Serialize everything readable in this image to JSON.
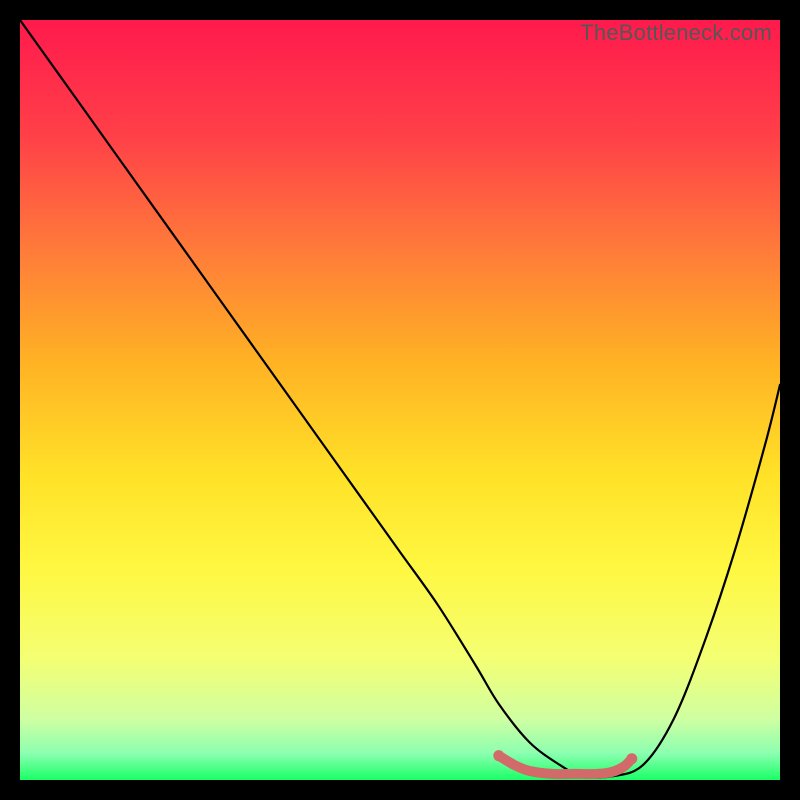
{
  "watermark": "TheBottleneck.com",
  "chart_data": {
    "type": "line",
    "title": "",
    "xlabel": "",
    "ylabel": "",
    "xlim": [
      0,
      100
    ],
    "ylim": [
      0,
      100
    ],
    "gradient_stops": [
      {
        "offset": 0.0,
        "color": "#ff1a4d"
      },
      {
        "offset": 0.15,
        "color": "#ff3f48"
      },
      {
        "offset": 0.3,
        "color": "#ff7a3a"
      },
      {
        "offset": 0.45,
        "color": "#ffb224"
      },
      {
        "offset": 0.6,
        "color": "#ffe228"
      },
      {
        "offset": 0.72,
        "color": "#fff741"
      },
      {
        "offset": 0.84,
        "color": "#f4ff73"
      },
      {
        "offset": 0.92,
        "color": "#cfffa2"
      },
      {
        "offset": 0.965,
        "color": "#8bffb0"
      },
      {
        "offset": 1.0,
        "color": "#1aff66"
      }
    ],
    "series": [
      {
        "name": "bottleneck-curve",
        "stroke": "#000000",
        "x": [
          0,
          5,
          10,
          15,
          20,
          25,
          30,
          35,
          40,
          45,
          50,
          55,
          60,
          63,
          67,
          71,
          74,
          78,
          82,
          86,
          90,
          94,
          98,
          100
        ],
        "values": [
          100,
          93,
          86,
          79,
          72,
          65,
          58,
          51,
          44,
          37,
          30,
          23,
          15,
          10,
          5,
          2,
          0.5,
          0.5,
          2,
          8,
          18,
          30,
          44,
          52
        ]
      },
      {
        "name": "optimal-zone-marker",
        "stroke": "#d36a6a",
        "stroke_width": 10,
        "x": [
          63,
          65,
          67,
          70,
          73,
          76,
          78,
          79.5,
          80.5
        ],
        "values": [
          3.2,
          2.0,
          1.2,
          0.8,
          0.8,
          0.8,
          1.1,
          1.8,
          2.8
        ]
      }
    ],
    "marker_endpoints": [
      {
        "x": 63,
        "y": 3.2,
        "r": 5.5,
        "fill": "#d36a6a"
      },
      {
        "x": 80.5,
        "y": 2.8,
        "r": 5.5,
        "fill": "#d36a6a"
      }
    ]
  }
}
